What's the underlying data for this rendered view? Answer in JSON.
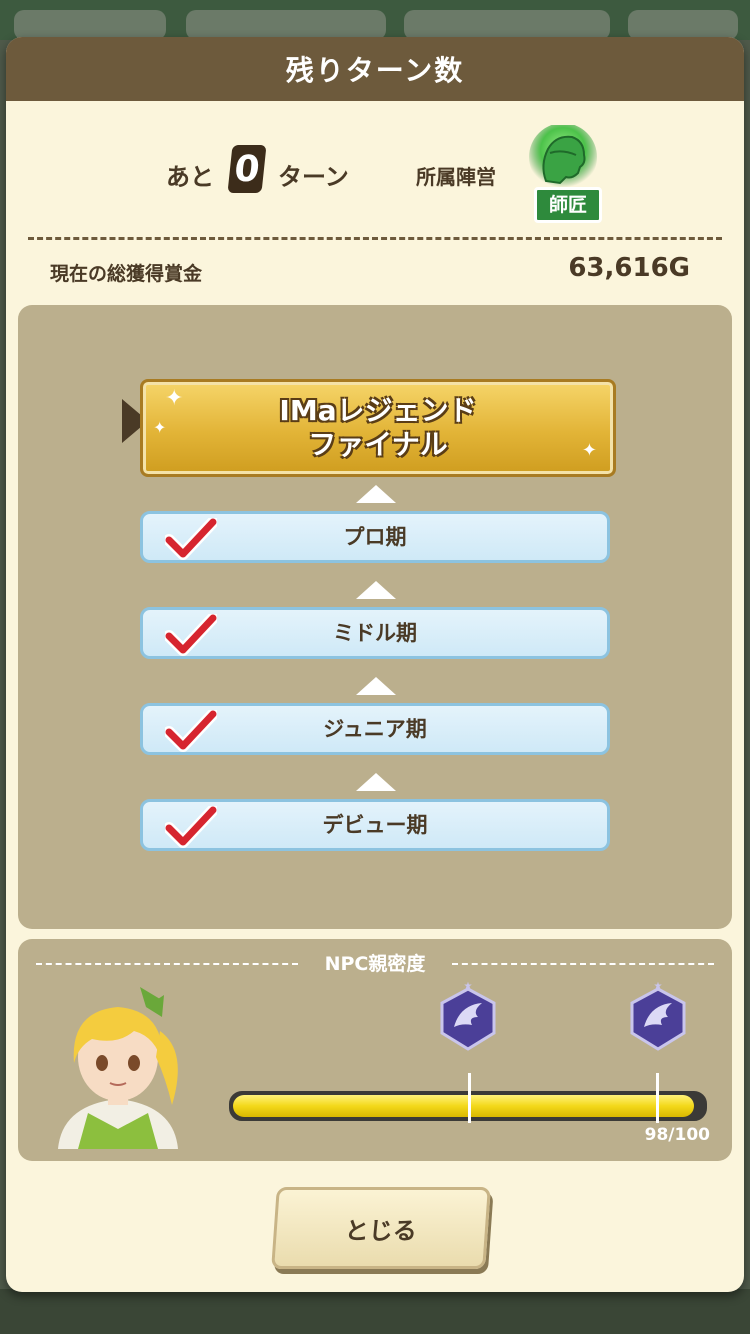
{
  "header": {
    "title": "残りターン数"
  },
  "turns": {
    "prefix": "あと",
    "count": "0",
    "suffix": "ターン"
  },
  "faction": {
    "label": "所属陣営",
    "name": "師匠",
    "emblem_icon": "guild-emblem-icon",
    "color": "#2e8a3c"
  },
  "prize": {
    "label": "現在の総獲得賞金",
    "value": "63,616G"
  },
  "stages": {
    "final": {
      "title": "IMaレジェンド\nファイナル",
      "current": true
    },
    "items": [
      {
        "label": "プロ期",
        "completed": true
      },
      {
        "label": "ミドル期",
        "completed": true
      },
      {
        "label": "ジュニア期",
        "completed": true
      },
      {
        "label": "デビュー期",
        "completed": true
      }
    ]
  },
  "npc": {
    "title": "NPC親密度",
    "value_text": "98/100",
    "progress": 0.98,
    "milestones": [
      0.5,
      0.9
    ],
    "medal_icon": "wing-medal-icon"
  },
  "close_button": {
    "label": "とじる"
  }
}
